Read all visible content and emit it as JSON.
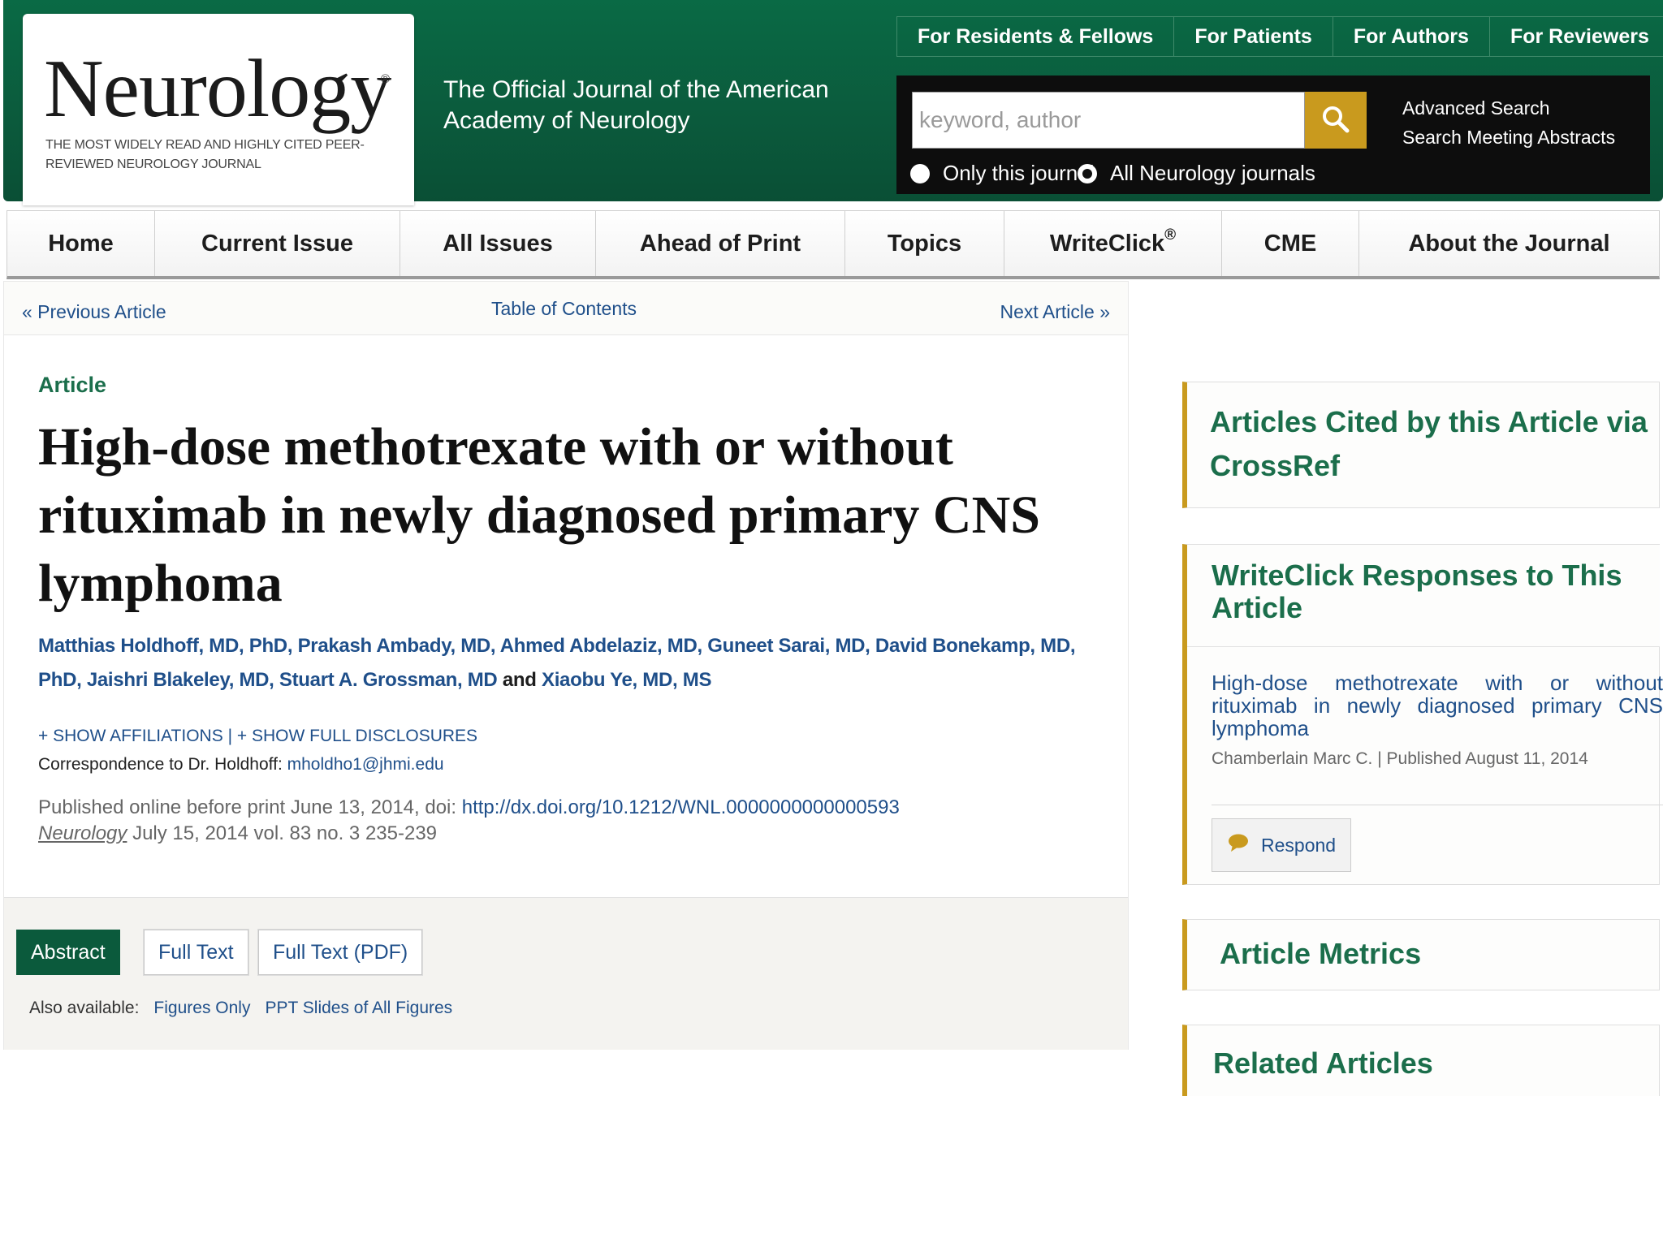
{
  "header": {
    "logo_word": "Neurology",
    "logo_reg": "®",
    "logo_tagline": "The most widely read and highly cited peer-reviewed neurology journal",
    "journal_desc": "The Official Journal of the American Academy of Neurology",
    "top_links": [
      "For Residents & Fellows",
      "For Patients",
      "For Authors",
      "For Reviewers"
    ],
    "search": {
      "placeholder": "keyword, author",
      "radio_only_this": "Only this journal",
      "radio_all": "All Neurology journals",
      "advanced": "Advanced Search",
      "meeting": "Search Meeting Abstracts"
    }
  },
  "nav": {
    "items": [
      "Home",
      "Current Issue",
      "All Issues",
      "Ahead of Print",
      "Topics",
      "WriteClick",
      "CME",
      "About the Journal"
    ],
    "writeclick_mark": "®"
  },
  "pager": {
    "prev": "« Previous Article",
    "toc": "Table of Contents",
    "next": "Next Article »"
  },
  "article": {
    "type": "Article",
    "title": "High-dose methotrexate with or without rituximab in newly diagnosed primary CNS lymphoma",
    "authors_part1": "Matthias Holdhoff, MD, PhD, Prakash Ambady, MD, Ahmed Abdelaziz, MD, Guneet Sarai, MD, David Bonekamp, MD, PhD, Jaishri Blakeley, MD, Stuart A. Grossman, MD",
    "authors_and": " and ",
    "authors_part2": "Xiaobu Ye, MD, MS",
    "show_affiliations": "+ SHOW AFFILIATIONS",
    "show_sep": " | ",
    "show_disclosures": "+ SHOW FULL DISCLOSURES",
    "corresp_label": "Correspondence to Dr. Holdhoff: ",
    "corresp_email": "mholdho1@jhmi.edu",
    "pub_online": "Published online before print June 13, 2014, doi: ",
    "doi": "http://dx.doi.org/10.1212/WNL.0000000000000593",
    "journal_name": "Neurology",
    "citation": " July 15, 2014 vol. 83 no. 3 235-239"
  },
  "tools": {
    "abstract": "Abstract",
    "full_text": "Full Text",
    "full_pdf": "Full Text (PDF)",
    "also_label": "Also available:",
    "figures_only": "Figures Only",
    "ppt": "PPT Slides of All Figures"
  },
  "sidebar": {
    "cited": "Articles Cited by this Article via CrossRef",
    "writeclick": "WriteClick Responses to This Article",
    "wc_item_title": "High-dose methotrexate with or without rituximab in newly diagnosed primary CNS lymphoma",
    "wc_item_meta": "Chamberlain Marc C. | Published August 11, 2014",
    "respond": "Respond",
    "metrics": "Article Metrics",
    "related": "Related Articles"
  },
  "colors": {
    "brand_green": "#0b5a3c",
    "accent_gold": "#c99a1e",
    "link_blue": "#1f4f8a"
  }
}
